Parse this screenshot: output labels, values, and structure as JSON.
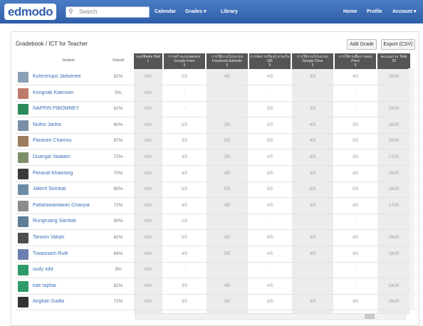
{
  "app": {
    "logo": "edmodo",
    "search_placeholder": "Search"
  },
  "nav_left": [
    "Calendar",
    "Grades ▾",
    "Library"
  ],
  "nav_right": [
    "Home",
    "Profile",
    "Account ▾"
  ],
  "breadcrumb": "Gradebook / ICT for Teacher",
  "buttons": {
    "add_grade": "Add Grade",
    "export": "Export (CSV)"
  },
  "table": {
    "student_header": "Student",
    "overall_header": "Overall",
    "columns": [
      {
        "label": "เบอร์ติดต่อ Mail",
        "max": "1"
      },
      {
        "label": "การสร้างแบบทดสอบ Google Form",
        "max": "5"
      },
      {
        "label": "การใช้งานโปรแกรม Facebook Edmodo",
        "max": "5"
      },
      {
        "label": "การจัดการเรียนรู้ ผ่านเว็บ QR",
        "max": "5"
      },
      {
        "label": "การใช้งานโปรแกรม Google Drive",
        "max": "5"
      },
      {
        "label": "การใช้งานสื่อการสอน Prezi",
        "max": "5"
      },
      {
        "label": "คะแนนรวม Total",
        "max": "20"
      }
    ],
    "rows": [
      {
        "name": "Kuleronops Jadsenee",
        "avatar": "#8aa0b4",
        "overall": "82%",
        "cells": [
          "N/A",
          "2/5",
          "4/5",
          "4/5",
          "3/5",
          "4/5",
          "16/20"
        ]
      },
      {
        "name": "Kungnak Kaenvan",
        "avatar": "#c07a6a",
        "overall": "5%",
        "cells": [
          "N/A",
          "-",
          "-",
          "-",
          "-",
          "-",
          "-"
        ]
      },
      {
        "name": "NAPPIN PIBOMNEY",
        "avatar": "#2b8a5a",
        "overall": "62%",
        "cells": [
          "N/A",
          "-",
          "-",
          "3/5",
          "3/5",
          "-",
          "14/20"
        ]
      },
      {
        "name": "Nutho Jantor",
        "avatar": "#7b8fa6",
        "overall": "60%",
        "cells": [
          "N/A",
          "5/5",
          "3/5",
          "3/5",
          "4/5",
          "3/5",
          "15/20"
        ]
      },
      {
        "name": "Paranee Chamsu",
        "avatar": "#9d7b5c",
        "overall": "87%",
        "cells": [
          "N/A",
          "3/5",
          "5/5",
          "5/5",
          "4/5",
          "5/5",
          "20/20"
        ]
      },
      {
        "name": "Duangdi Vaalaim",
        "avatar": "#7e8e6a",
        "overall": "72%",
        "cells": [
          "N/A",
          "4/5",
          "3/5",
          "4/5",
          "4/5",
          "3/5",
          "17/20"
        ]
      },
      {
        "name": "Peravat Khawsing",
        "avatar": "#3a3a3a",
        "overall": "70%",
        "cells": [
          "N/A",
          "4/5",
          "4/5",
          "3/5",
          "3/5",
          "4/5",
          "16/20"
        ]
      },
      {
        "name": "Jakkrit Sombat",
        "avatar": "#6c8da8",
        "overall": "85%",
        "cells": [
          "N/A",
          "5/5",
          "5/5",
          "5/5",
          "5/5",
          "5/5",
          "19/20"
        ]
      },
      {
        "name": "Pattarawanawan Chaoyia",
        "avatar": "#8c8c8c",
        "overall": "72%",
        "cells": [
          "N/A",
          "4/5",
          "4/5",
          "4/5",
          "3/5",
          "4/5",
          "17/20"
        ]
      },
      {
        "name": "Rungruang Sambat",
        "avatar": "#5b7d98",
        "overall": "90%",
        "cells": [
          "N/A",
          "2/5",
          "-",
          "-",
          "-",
          "-",
          "-"
        ]
      },
      {
        "name": "Tanoon Vakan",
        "avatar": "#4d4d4d",
        "overall": "82%",
        "cells": [
          "N/A",
          "5/5",
          "3/5",
          "5/5",
          "3/5",
          "4/5",
          "18/20"
        ]
      },
      {
        "name": "Tiwasnarin Rulti",
        "avatar": "#6d7fb0",
        "overall": "84%",
        "cells": [
          "N/A",
          "4/5",
          "5/5",
          "4/5",
          "4/5",
          "4/5",
          "18/20"
        ]
      },
      {
        "name": "uudy xdd",
        "avatar": "#2f9a6a",
        "overall": "3%",
        "cells": [
          "N/A",
          "-",
          "-",
          "-",
          "-",
          "-",
          "-"
        ]
      },
      {
        "name": "kae raphai",
        "avatar": "#2f9a6a",
        "overall": "82%",
        "cells": [
          "N/A",
          "3/5",
          "4/5",
          "4/5",
          "-",
          "-",
          "14/20"
        ]
      },
      {
        "name": "Angkan Sudta",
        "avatar": "#333333",
        "overall": "72%",
        "cells": [
          "N/A",
          "3/5",
          "3/5",
          "3/5",
          "4/5",
          "3/5",
          "16/20"
        ]
      }
    ]
  }
}
